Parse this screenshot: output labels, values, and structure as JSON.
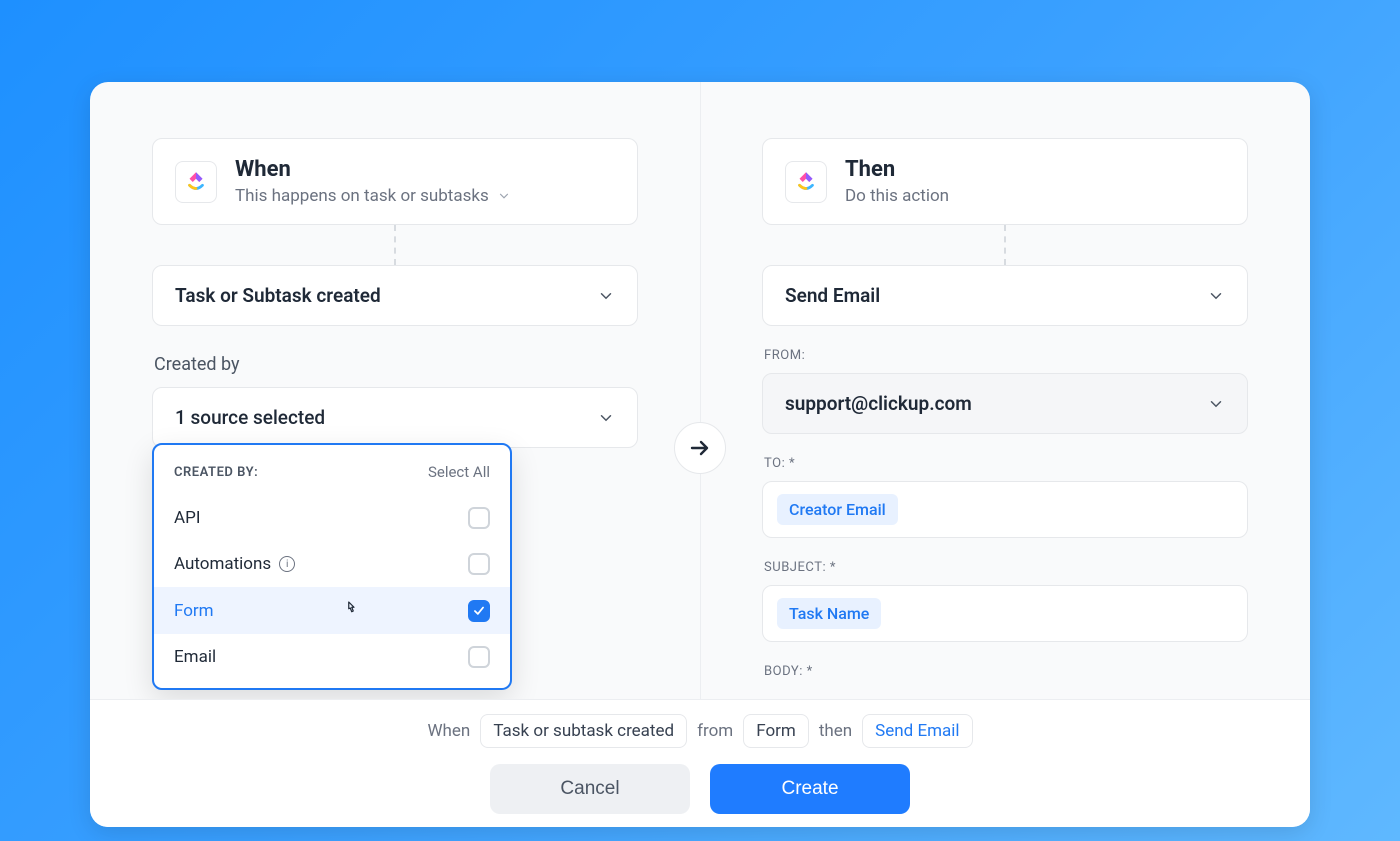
{
  "when": {
    "title": "When",
    "subtitle": "This happens on task or subtasks",
    "trigger_label": "Task or Subtask created",
    "created_by_label": "Created by",
    "source_summary": "1 source selected",
    "panel": {
      "title": "CREATED BY:",
      "select_all": "Select All",
      "options": [
        {
          "label": "API",
          "checked": false,
          "info": false
        },
        {
          "label": "Automations",
          "checked": false,
          "info": true
        },
        {
          "label": "Form",
          "checked": true,
          "info": false
        },
        {
          "label": "Email",
          "checked": false,
          "info": false
        }
      ]
    }
  },
  "then": {
    "title": "Then",
    "subtitle": "Do this action",
    "action_label": "Send Email",
    "from_label": "FROM:",
    "from_value": "support@clickup.com",
    "to_label": "TO: *",
    "to_token": "Creator Email",
    "subject_label": "SUBJECT: *",
    "subject_token": "Task Name",
    "body_label": "BODY: *"
  },
  "footer": {
    "when_word": "When",
    "trigger_chip": "Task or subtask created",
    "from_word": "from",
    "source_chip": "Form",
    "then_word": "then",
    "action_chip": "Send Email",
    "cancel": "Cancel",
    "create": "Create"
  }
}
